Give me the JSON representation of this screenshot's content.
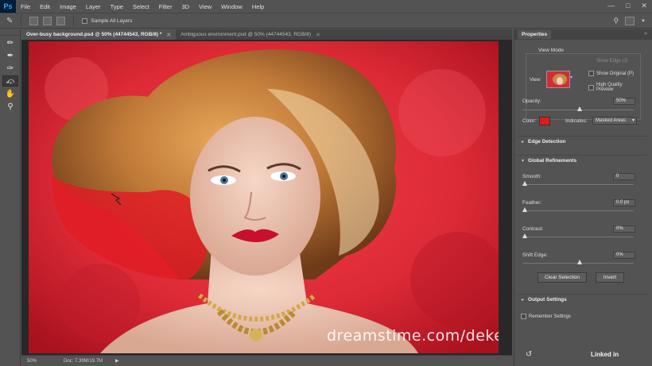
{
  "app": {
    "logo": "Ps",
    "menu": [
      "File",
      "Edit",
      "Image",
      "Layer",
      "Type",
      "Select",
      "Filter",
      "3D",
      "View",
      "Window",
      "Help"
    ]
  },
  "options_bar": {
    "sample_all_layers": "Sample All Layers"
  },
  "tabs": [
    {
      "label": "Over-busy background.psd @ 50% (44744543, RGB/8) *",
      "active": true
    },
    {
      "label": "Ambiguous environment.psd @ 50% (44744543, RGB/8)",
      "active": false
    }
  ],
  "canvas": {
    "watermark": "dreamstime.com/deke"
  },
  "status": {
    "zoom": "50%",
    "doc": "Doc: 7.39M/19.7M"
  },
  "properties": {
    "tab": "Properties",
    "view_mode": {
      "title": "View Mode",
      "view_label": "View:",
      "show_edge": "Show Edge (J)",
      "show_original": "Show Original (P)",
      "high_quality": "High Quality Preview"
    },
    "opacity": {
      "label": "Opacity:",
      "value": "50%",
      "level": 0.5
    },
    "color_label": "Color:",
    "color_value": "#e11a1a",
    "indicates_label": "Indicates:",
    "indicates_value": "Masked Areas",
    "edge_detection": "Edge Detection",
    "global_refinements": "Global Refinements",
    "smooth": {
      "label": "Smooth:",
      "value": "0",
      "level": 0
    },
    "feather": {
      "label": "Feather:",
      "value": "0.0 px",
      "level": 0
    },
    "contrast": {
      "label": "Contrast:",
      "value": "0%",
      "level": 0
    },
    "shift_edge": {
      "label": "Shift Edge:",
      "value": "0%",
      "level": 0.5
    },
    "clear_selection": "Clear Selection",
    "invert": "Invert",
    "output_settings": "Output Settings",
    "remember_settings": "Remember Settings"
  },
  "overlay_brand": "Linked in"
}
